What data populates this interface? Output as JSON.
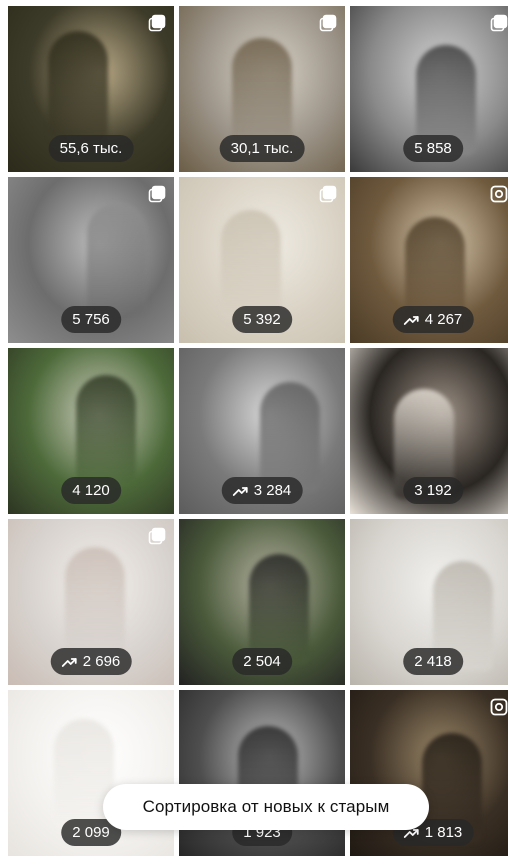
{
  "tiles": [
    {
      "views": "55,6 тыс.",
      "trend": false,
      "corner": "carousel-icon",
      "bg": [
        "#3c3a28",
        "#b9a987",
        "#2c2a1a"
      ]
    },
    {
      "views": "30,1 тыс.",
      "trend": false,
      "corner": "carousel-icon",
      "bg": [
        "#9a9286",
        "#d7d1c6",
        "#6b5d46"
      ]
    },
    {
      "views": "5 858",
      "trend": false,
      "corner": "carousel-icon",
      "bg": [
        "#8a8a8a",
        "#d2d2d2",
        "#3a3a3a"
      ]
    },
    {
      "views": "5 756",
      "trend": false,
      "corner": "carousel-icon",
      "bg": [
        "#6d6d6d",
        "#bdbdbd",
        "#8e8e8e"
      ]
    },
    {
      "views": "5 392",
      "trend": false,
      "corner": "carousel-icon",
      "bg": [
        "#d9d2c4",
        "#efebe3",
        "#c8bfae"
      ]
    },
    {
      "views": "4 267",
      "trend": true,
      "corner": "reel-icon",
      "bg": [
        "#6f5a3e",
        "#d7c7ad",
        "#4b3b26"
      ]
    },
    {
      "views": "4 120",
      "trend": false,
      "corner": "",
      "bg": [
        "#4d6a3a",
        "#cfcfbf",
        "#2d3522"
      ]
    },
    {
      "views": "3 284",
      "trend": true,
      "corner": "",
      "bg": [
        "#7a7a7a",
        "#d8d8d8",
        "#5c5c5c"
      ]
    },
    {
      "views": "3 192",
      "trend": false,
      "corner": "",
      "bg": [
        "#2a2622",
        "#9f9387",
        "#e9e3da"
      ]
    },
    {
      "views": "2 696",
      "trend": true,
      "corner": "carousel-icon",
      "bg": [
        "#d8d3cf",
        "#f2eeea",
        "#c9bcb4"
      ]
    },
    {
      "views": "2 504",
      "trend": false,
      "corner": "",
      "bg": [
        "#4a5a3a",
        "#b7b4a3",
        "#222222"
      ]
    },
    {
      "views": "2 418",
      "trend": false,
      "corner": "",
      "bg": [
        "#d9d6d1",
        "#f2f1ee",
        "#b9b4ab"
      ]
    },
    {
      "views": "2 099",
      "trend": false,
      "corner": "",
      "bg": [
        "#f4f2ef",
        "#ffffff",
        "#e7e4df"
      ]
    },
    {
      "views": "1 923",
      "trend": false,
      "corner": "",
      "bg": [
        "#4e4e4e",
        "#bdbdbd",
        "#262626"
      ]
    },
    {
      "views": "1 813",
      "trend": true,
      "corner": "reel-icon",
      "bg": [
        "#3a2f24",
        "#9a8768",
        "#1f1913"
      ]
    }
  ],
  "sort_toast": {
    "label": "Сортировка от новых к старым"
  },
  "colors": {
    "badge_bg": "#282828",
    "badge_text": "#ffffff",
    "toast_bg": "#ffffff"
  }
}
